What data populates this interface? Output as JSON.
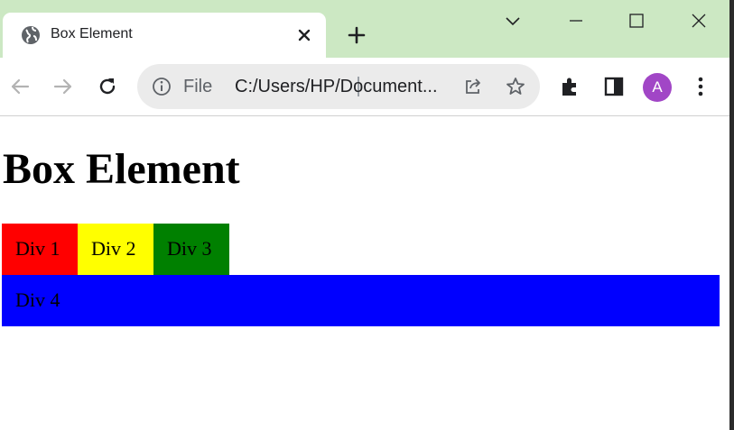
{
  "browser": {
    "tab": {
      "title": "Box Element",
      "icon": "globe-icon"
    },
    "omnibox": {
      "scheme_label": "File",
      "url": "C:/Users/HP/Document..."
    },
    "profile_initial": "A",
    "colors": {
      "tab_strip": "#cce8c3",
      "omnibox": "#ebebeb",
      "avatar": "#a146c6"
    }
  },
  "page": {
    "heading": "Box Element",
    "boxes": [
      {
        "label": "Div 1",
        "color": "#ff0000"
      },
      {
        "label": "Div 2",
        "color": "#ffff00"
      },
      {
        "label": "Div 3",
        "color": "#008000"
      },
      {
        "label": "Div 4",
        "color": "#0000ff"
      }
    ]
  }
}
